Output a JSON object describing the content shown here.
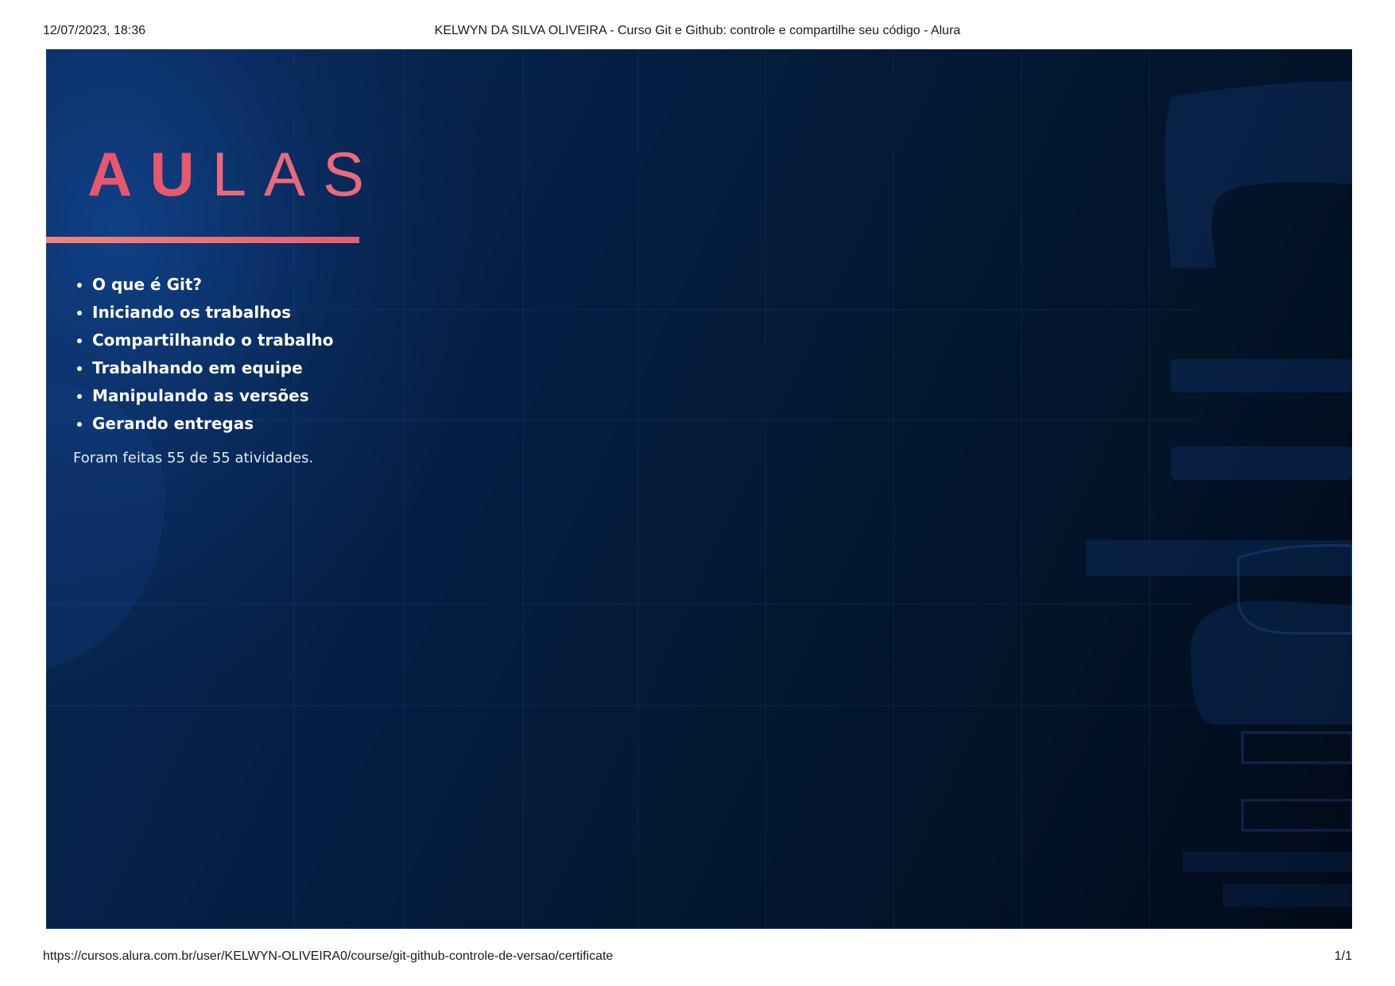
{
  "print_header": {
    "datetime": "12/07/2023, 18:36",
    "title": "KELWYN DA SILVA OLIVEIRA - Curso Git e Github: controle e compartilhe seu código - Alura"
  },
  "print_footer": {
    "url": "https://cursos.alura.com.br/user/KELWYN-OLIVEIRA0/course/git-github-controle-de-versao/certificate",
    "page": "1/1"
  },
  "certificate": {
    "heading_bold": "AU",
    "heading_light": "LAS",
    "lessons": [
      "O que é Git?",
      "Iniciando os trabalhos",
      "Compartilhando o trabalho",
      "Trabalhando em equipe",
      "Manipulando as versões",
      "Gerando entregas"
    ],
    "activities_text": "Foram feitas 55 de 55 atividades.",
    "watermark_text": "alura",
    "colors": {
      "accent": "#e8576c",
      "background_dark": "#041a38",
      "background_light": "#0a2a58"
    }
  }
}
